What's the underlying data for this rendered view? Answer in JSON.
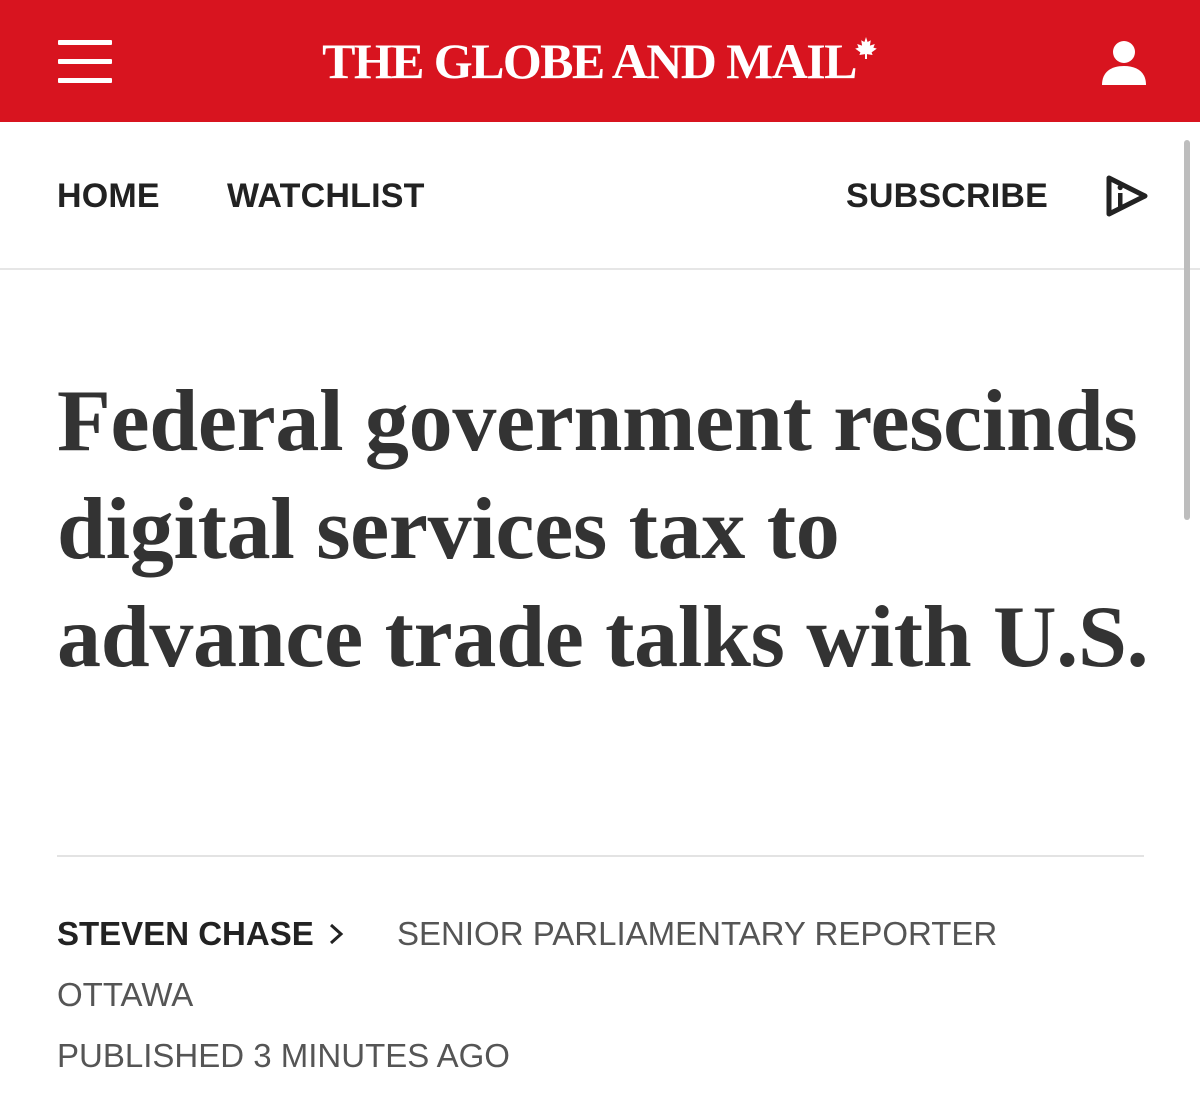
{
  "colors": {
    "brand_red": "#d8141f",
    "headline_text": "#333333",
    "meta_text": "#555555",
    "divider": "#e3e3e3"
  },
  "masthead": {
    "menu_icon": "hamburger-menu-icon",
    "logo": "THE GLOBE AND MAIL",
    "logo_icon": "maple-leaf-icon",
    "account_icon": "user-icon"
  },
  "nav": {
    "home": "HOME",
    "watchlist": "WATCHLIST",
    "subscribe": "SUBSCRIBE",
    "video_icon": "play-icon"
  },
  "article": {
    "headline": "Federal government rescinds digital services tax to advance trade talks with U.S.",
    "author": "STEVEN CHASE",
    "author_role": "SENIOR PARLIAMENTARY REPORTER",
    "location": "OTTAWA",
    "published": "PUBLISHED 3 MINUTES AGO"
  }
}
